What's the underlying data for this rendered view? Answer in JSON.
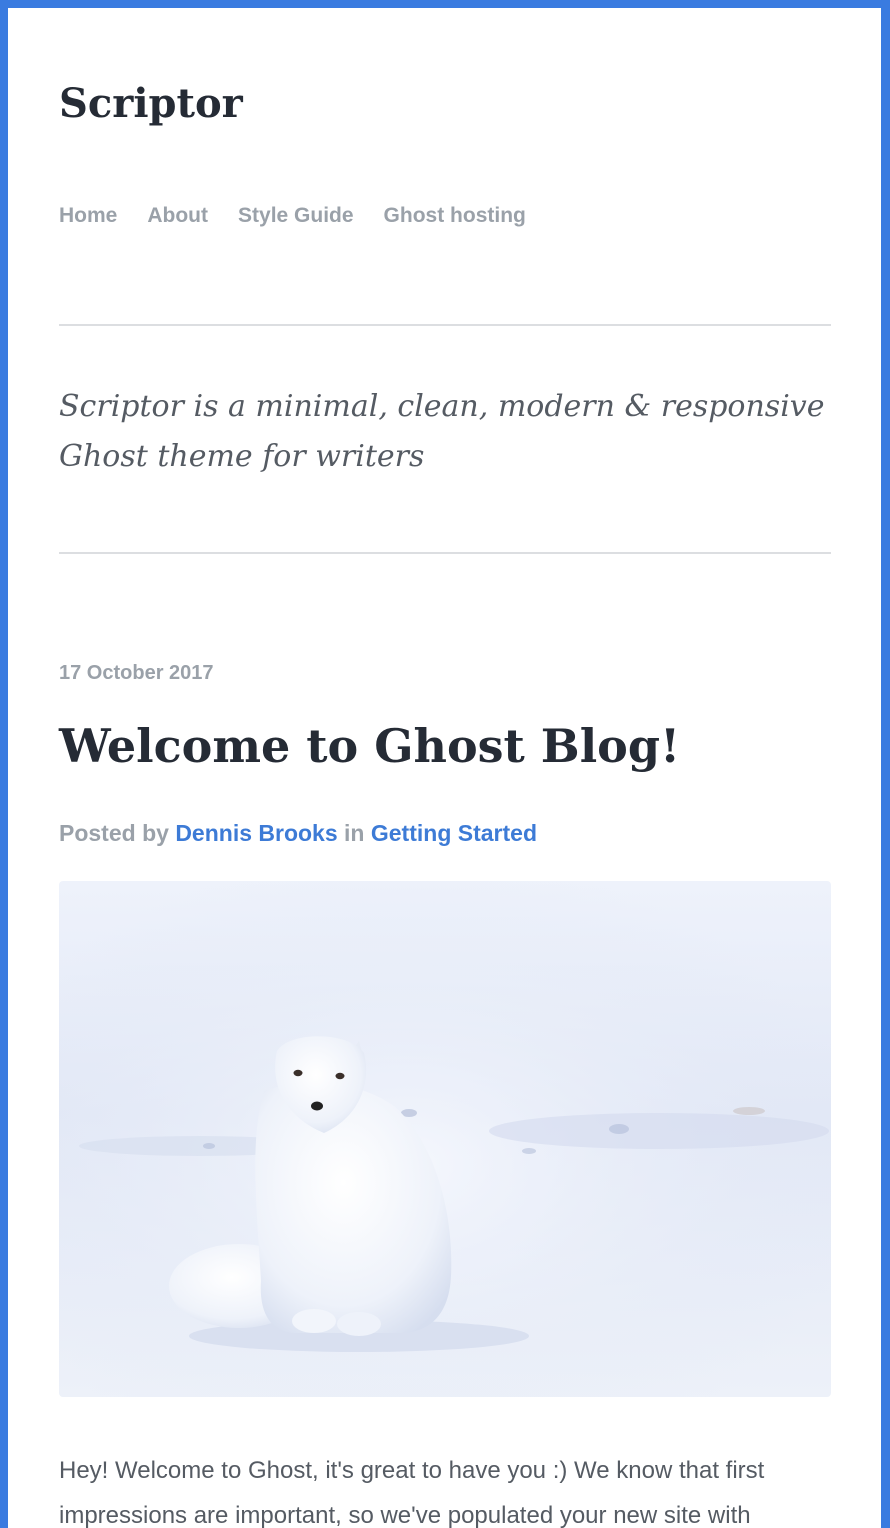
{
  "site": {
    "title": "Scriptor",
    "tagline": "Scriptor is a minimal, clean, modern & responsive Ghost theme for writers"
  },
  "nav": {
    "items": [
      {
        "label": "Home"
      },
      {
        "label": "About"
      },
      {
        "label": "Style Guide"
      },
      {
        "label": "Ghost hosting"
      }
    ]
  },
  "post": {
    "date": "17 October 2017",
    "title": "Welcome to Ghost Blog!",
    "byline": {
      "prefix": "Posted by",
      "author": "Dennis Brooks",
      "in_word": "in",
      "category": "Getting Started"
    },
    "image": {
      "icon": "arctic-fox-in-snow-photo"
    },
    "excerpt": "Hey! Welcome to Ghost, it's great to have you :) We know that first impressions are important, so we've populated your new site with"
  },
  "colors": {
    "frame": "#3a7be0",
    "link": "#3d7bd6",
    "muted": "#9aa1a9",
    "heading": "#252b35",
    "rule": "#dcdee1"
  }
}
